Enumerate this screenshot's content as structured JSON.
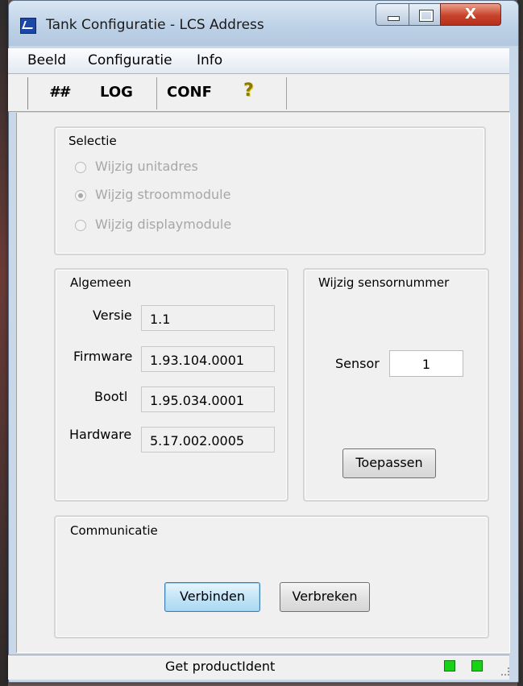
{
  "window": {
    "title": "Tank Configuratie - LCS Address",
    "controls": {
      "minimize_icon": "minimize-icon",
      "maximize_icon": "maximize-icon",
      "close_glyph": "X"
    }
  },
  "menubar": {
    "items": [
      "Beeld",
      "Configuratie",
      "Info"
    ]
  },
  "toolbar": {
    "hash_label": "##",
    "log_label": "LOG",
    "conf_label": "CONF",
    "help_glyph": "?"
  },
  "selectie": {
    "title": "Selectie",
    "options": [
      {
        "label": "Wijzig unitadres",
        "checked": false
      },
      {
        "label": "Wijzig stroommodule",
        "checked": true
      },
      {
        "label": "Wijzig displaymodule",
        "checked": false
      }
    ]
  },
  "algemeen": {
    "title": "Algemeen",
    "rows": [
      {
        "label": "Versie",
        "value": "1.1"
      },
      {
        "label": "Firmware",
        "value": "1.93.104.0001"
      },
      {
        "label": "Bootl",
        "value": "1.95.034.0001"
      },
      {
        "label": "Hardware",
        "value": "5.17.002.0005"
      }
    ]
  },
  "sensor": {
    "title": "Wijzig sensornummer",
    "label": "Sensor",
    "value": "1",
    "apply_label": "Toepassen"
  },
  "communicatie": {
    "title": "Communicatie",
    "connect_label": "Verbinden",
    "disconnect_label": "Verbreken"
  },
  "statusbar": {
    "text": "Get productIdent",
    "led_color": "#18d218"
  }
}
